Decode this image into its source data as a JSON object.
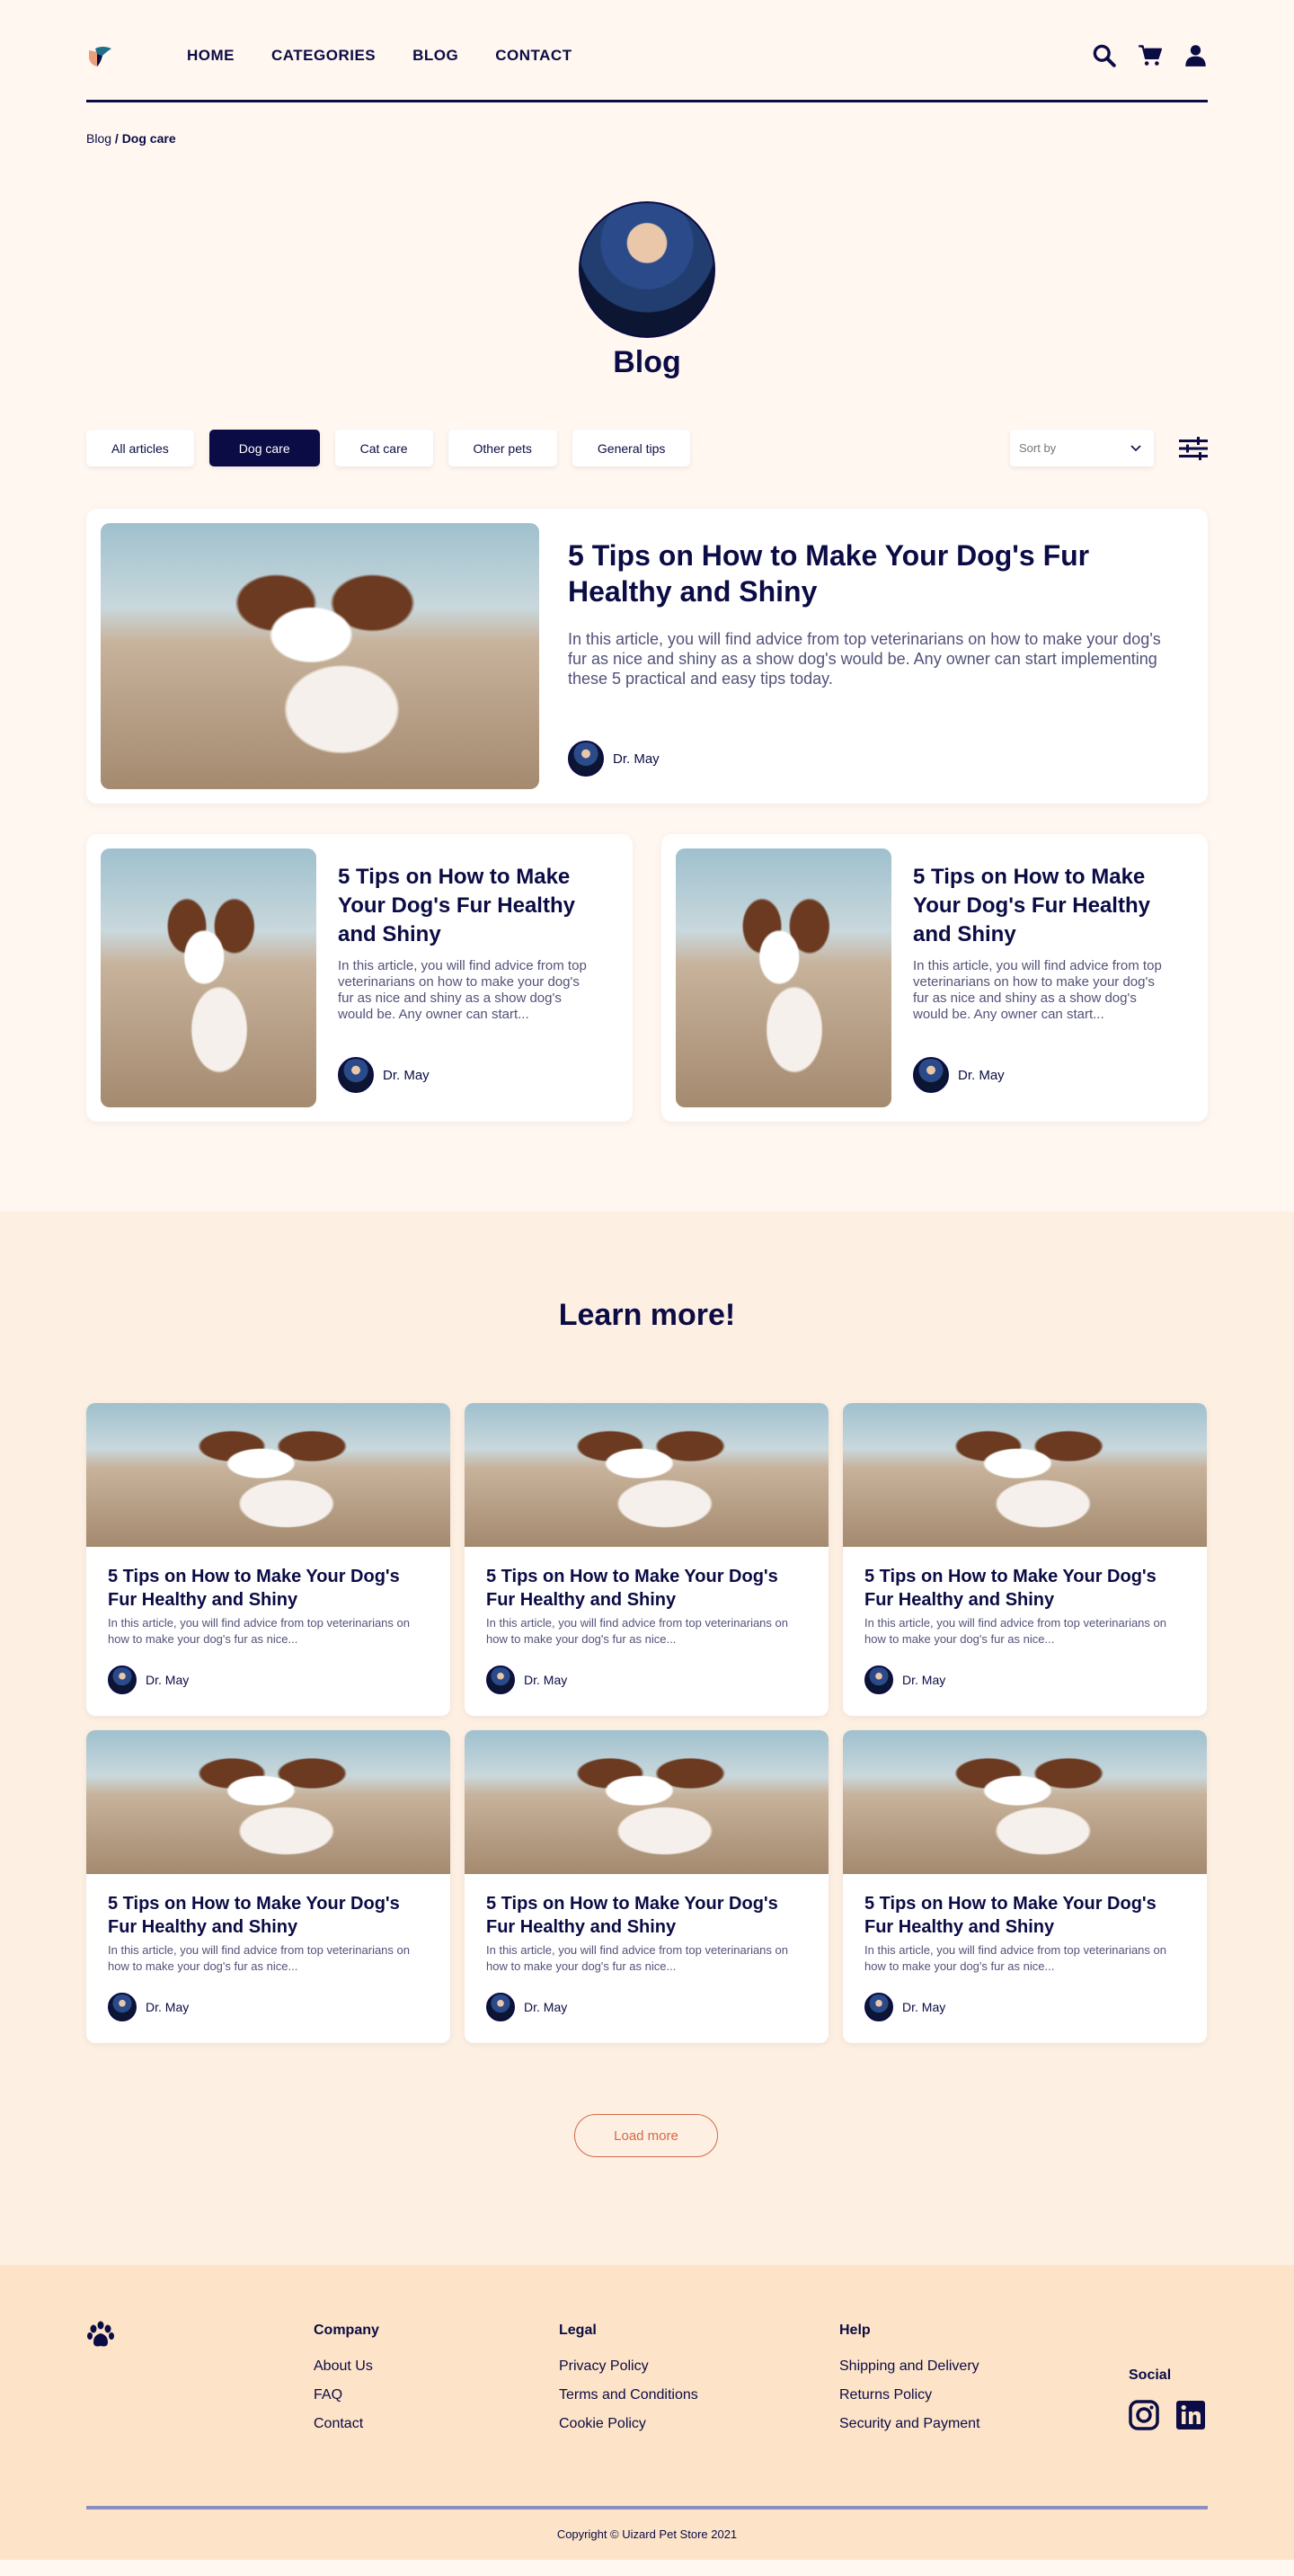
{
  "nav": {
    "items": [
      "HOME",
      "CATEGORIES",
      "BLOG",
      "CONTACT"
    ],
    "icons": [
      "search-icon",
      "cart-icon",
      "user-icon"
    ]
  },
  "breadcrumb": {
    "root": "Blog",
    "current": "/ Dog care"
  },
  "hero": {
    "title": "Blog"
  },
  "filters": {
    "chips": [
      "All articles",
      "Dog care",
      "Cat care",
      "Other pets",
      "General tips"
    ],
    "active": "Dog care",
    "sort_placeholder": "Sort by"
  },
  "featured": {
    "title": "5 Tips on How to Make Your Dog's Fur Healthy and Shiny",
    "excerpt": "In this article, you will find advice from top veterinarians on how to make your dog's fur as nice and shiny as a show dog's would be. Any owner can start implementing these 5 practical and easy tips today.",
    "author": "Dr. May"
  },
  "secondary": [
    {
      "title": "5 Tips on How to Make Your Dog's Fur Healthy and Shiny",
      "excerpt": "In this article, you will find advice from top veterinarians on how to make your dog's fur as nice and shiny as a show dog's would be. Any owner can start...",
      "author": "Dr. May"
    },
    {
      "title": "5 Tips on How to Make Your Dog's Fur Healthy and Shiny",
      "excerpt": "In this article, you will find advice from top veterinarians on how to make your dog's fur as nice and shiny as a show dog's would be. Any owner can start...",
      "author": "Dr. May"
    }
  ],
  "learn": {
    "title": "Learn more!",
    "cards": [
      {
        "title": "5 Tips on How to Make Your Dog's Fur Healthy and Shiny",
        "excerpt": "In this article, you will find advice from top veterinarians on how to make your dog's fur as nice...",
        "author": "Dr. May"
      },
      {
        "title": "5 Tips on How to Make Your Dog's Fur Healthy and Shiny",
        "excerpt": "In this article, you will find advice from top veterinarians on how to make your dog's fur as nice...",
        "author": "Dr. May"
      },
      {
        "title": "5 Tips on How to Make Your Dog's Fur Healthy and Shiny",
        "excerpt": "In this article, you will find advice from top veterinarians on how to make your dog's fur as nice...",
        "author": "Dr. May"
      },
      {
        "title": "5 Tips on How to Make Your Dog's Fur Healthy and Shiny",
        "excerpt": "In this article, you will find advice from top veterinarians on how to make your dog's fur as nice...",
        "author": "Dr. May"
      },
      {
        "title": "5 Tips on How to Make Your Dog's Fur Healthy and Shiny",
        "excerpt": "In this article, you will find advice from top veterinarians on how to make your dog's fur as nice...",
        "author": "Dr. May"
      },
      {
        "title": "5 Tips on How to Make Your Dog's Fur Healthy and Shiny",
        "excerpt": "In this article, you will find advice from top veterinarians on how to make your dog's fur as nice...",
        "author": "Dr. May"
      }
    ],
    "load_more": "Load more"
  },
  "footer": {
    "columns": [
      {
        "heading": "Company",
        "links": [
          "About Us",
          "FAQ",
          "Contact"
        ]
      },
      {
        "heading": "Legal",
        "links": [
          "Privacy Policy",
          "Terms and Conditions",
          "Cookie Policy"
        ]
      },
      {
        "heading": "Help",
        "links": [
          "Shipping and Delivery",
          "Returns Policy",
          "Security and Payment"
        ]
      }
    ],
    "social_heading": "Social",
    "social_icons": [
      "instagram-icon",
      "linkedin-icon"
    ],
    "copyright": "Copyright © Uizard Pet Store 2021"
  },
  "colors": {
    "navy": "#0b0b45",
    "cream": "#fff7f0",
    "peach": "#fdefe1",
    "footer": "#fde4c8",
    "accent": "#d46a4a"
  }
}
